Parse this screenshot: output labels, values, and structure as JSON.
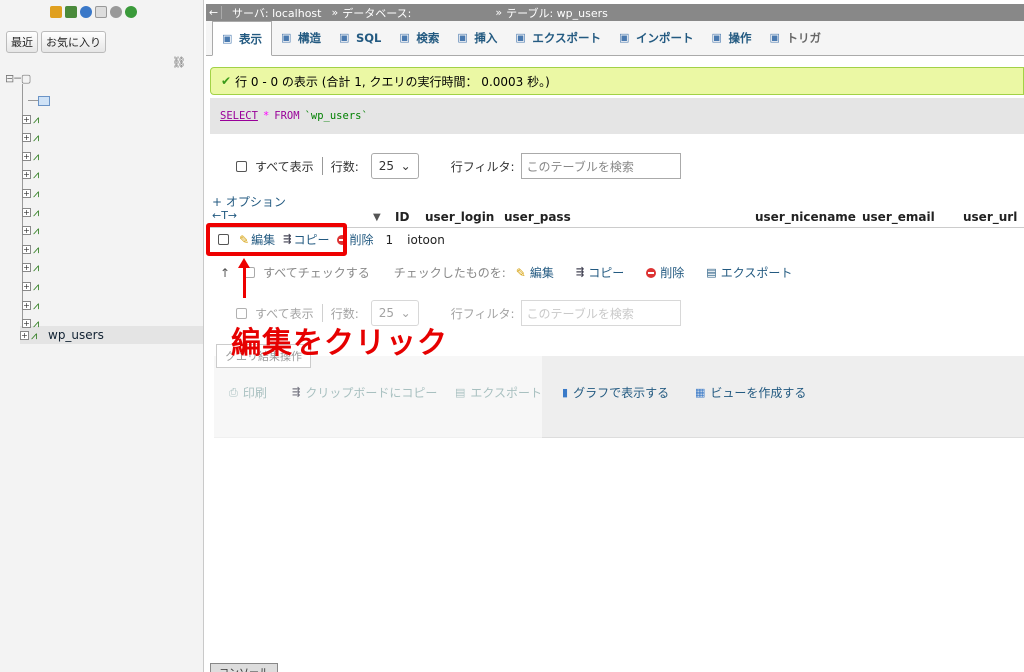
{
  "nav": {
    "recent_label": "最近",
    "favorites_label": "お気に入り",
    "tables_count": 13,
    "active_table": "wp_users"
  },
  "breadcrumb": {
    "server": "サーバ: localhost",
    "database": "データベース:",
    "table": "テーブル: wp_users",
    "separator": "»"
  },
  "tabs": [
    {
      "label": "表示",
      "icon": "browse-icon"
    },
    {
      "label": "構造",
      "icon": "structure-icon"
    },
    {
      "label": "SQL",
      "icon": "sql-icon"
    },
    {
      "label": "検索",
      "icon": "search-icon"
    },
    {
      "label": "挿入",
      "icon": "insert-icon"
    },
    {
      "label": "エクスポート",
      "icon": "export-icon"
    },
    {
      "label": "インポート",
      "icon": "import-icon"
    },
    {
      "label": "操作",
      "icon": "wrench-icon"
    },
    {
      "label": "トリガ",
      "icon": "trigger-icon"
    }
  ],
  "success": "行 0 - 0 の表示 (合計 1, クエリの実行時間： 0.0003 秒。)",
  "sql": {
    "select": "SELECT",
    "star": "*",
    "from": "FROM",
    "table": "`wp_users`"
  },
  "controls": {
    "show_all": "すべて表示",
    "rows_label": "行数:",
    "rows_value": "25",
    "filter_label": "行フィルタ:",
    "filter_placeholder": "このテーブルを検索"
  },
  "options_link": "+ オプション",
  "sort_arrows": "←T→",
  "columns": {
    "id": "ID",
    "login": "user_login",
    "pass": "user_pass",
    "nicename": "user_nicename",
    "email": "user_email",
    "url": "user_url",
    "sort_arrow": "▼"
  },
  "row": {
    "edit": "編集",
    "copy": "コピー",
    "delete": "削除",
    "id": "1",
    "login": "iotoon"
  },
  "bulk": {
    "check_all": "すべてチェックする",
    "with_selected": "チェックしたものを:",
    "edit": "編集",
    "copy": "コピー",
    "delete": "削除",
    "export": "エクスポート"
  },
  "annotation": "編集をクリック",
  "query_ops": {
    "legend": "クエリ結果操作",
    "print": "印刷",
    "copy_clipboard": "クリップボードにコピー",
    "export": "エクスポート",
    "chart": "グラフで表示する",
    "create_view": "ビューを作成する"
  },
  "console_label": "コンソール",
  "colors": {
    "accent": "#235a81",
    "annotation": "#ee0000",
    "success_bg": "#ebf8a4"
  }
}
